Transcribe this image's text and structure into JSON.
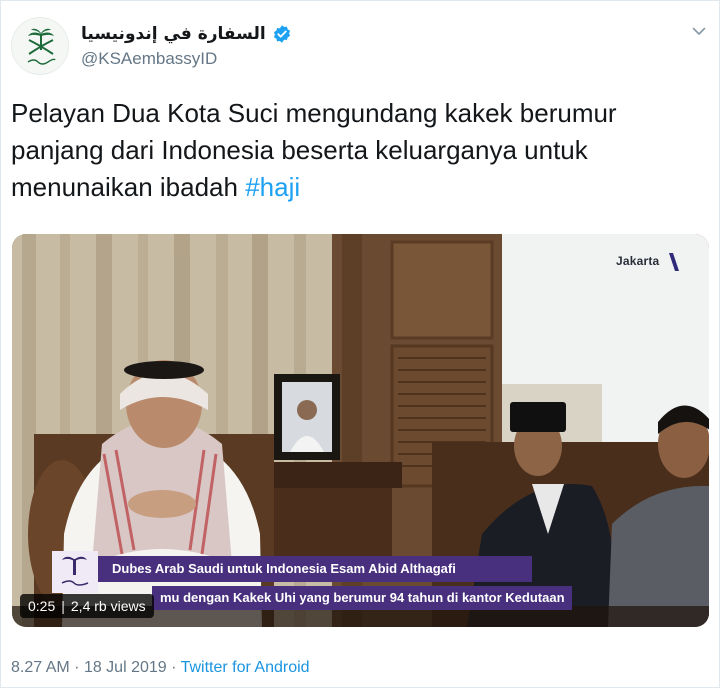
{
  "account": {
    "display_name": "السفارة في إندونيسيا",
    "handle": "@KSAembassyID",
    "verified": true,
    "avatar_icon": "saudi-emblem-icon"
  },
  "menu": {
    "icon": "chevron-down-icon"
  },
  "tweet": {
    "text_main": "Pelayan Dua Kota Suci mengundang kakek berumur panjang dari Indonesia beserta keluarganya untuk menunaikan ibadah ",
    "hashtag": "#haji"
  },
  "media": {
    "location_tag": "Jakarta",
    "lower_third_1": "Dubes Arab Saudi untuk Indonesia Esam Abid Althagafi",
    "lower_third_2": "mu dengan Kakek Uhi yang berumur 94 tahun di kantor Kedutaan",
    "video_time": "0:25",
    "video_views": "2,4 rb views"
  },
  "footer": {
    "time": "8.27 AM",
    "separator_1": "·",
    "date": "18 Jul 2019",
    "separator_2": "·",
    "source": "Twitter for Android"
  },
  "colors": {
    "link_blue": "#1da1f2",
    "source_blue": "#1b95e0",
    "secondary_text": "#657786",
    "lower_third_purple": "#48307e",
    "verified_blue": "#1da1f2"
  }
}
